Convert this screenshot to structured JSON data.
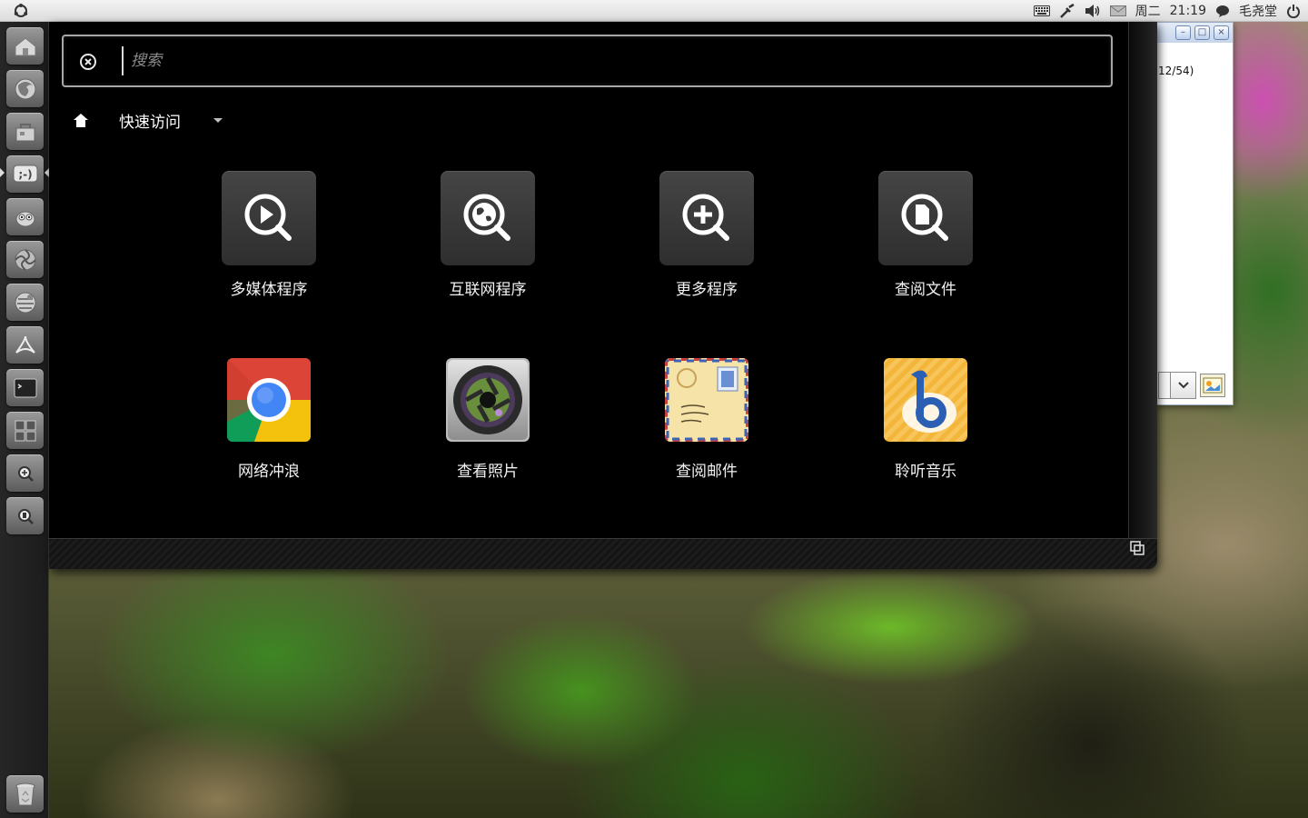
{
  "top_panel": {
    "day": "周二",
    "time": "21:19",
    "user": "毛尧堂",
    "indicators": [
      "keyboard-icon",
      "network-icon",
      "volume-icon",
      "mail-icon",
      "chat-icon",
      "power-icon"
    ]
  },
  "launcher": {
    "items": [
      {
        "name": "home-folder-icon"
      },
      {
        "name": "firefox-icon"
      },
      {
        "name": "software-center-icon"
      },
      {
        "name": "empathy-icon"
      },
      {
        "name": "gimp-icon"
      },
      {
        "name": "shutter-icon"
      },
      {
        "name": "gnome-globe-icon"
      },
      {
        "name": "pdf-reader-icon"
      },
      {
        "name": "terminal-icon"
      },
      {
        "name": "workspace-switcher-icon"
      },
      {
        "name": "applications-lens-icon"
      },
      {
        "name": "files-lens-icon"
      }
    ],
    "trash": "trash-icon"
  },
  "dash": {
    "search": {
      "placeholder": "搜索",
      "value": ""
    },
    "lens": {
      "label": "快速访问"
    },
    "categories": [
      {
        "label": "多媒体程序",
        "icon": "media-search-icon"
      },
      {
        "label": "互联网程序",
        "icon": "internet-search-icon"
      },
      {
        "label": "更多程序",
        "icon": "more-apps-search-icon"
      },
      {
        "label": "查阅文件",
        "icon": "documents-search-icon"
      }
    ],
    "apps": [
      {
        "label": "网络冲浪",
        "icon": "chrome-icon"
      },
      {
        "label": "查看照片",
        "icon": "shotwell-camera-icon"
      },
      {
        "label": "查阅邮件",
        "icon": "mail-envelope-icon"
      },
      {
        "label": "聆听音乐",
        "icon": "banshee-music-icon"
      }
    ]
  },
  "background_window": {
    "counter_text": "12/54)"
  },
  "colors": {
    "dash_bg": "#000000",
    "panel_bg": "#e6e6e6",
    "launcher_bg": "#222222",
    "chrome_red": "#db4437",
    "chrome_green": "#0f9d58",
    "chrome_yellow": "#f4c20d",
    "chrome_blue": "#4285f4",
    "banshee_orange": "#f3b53a"
  }
}
